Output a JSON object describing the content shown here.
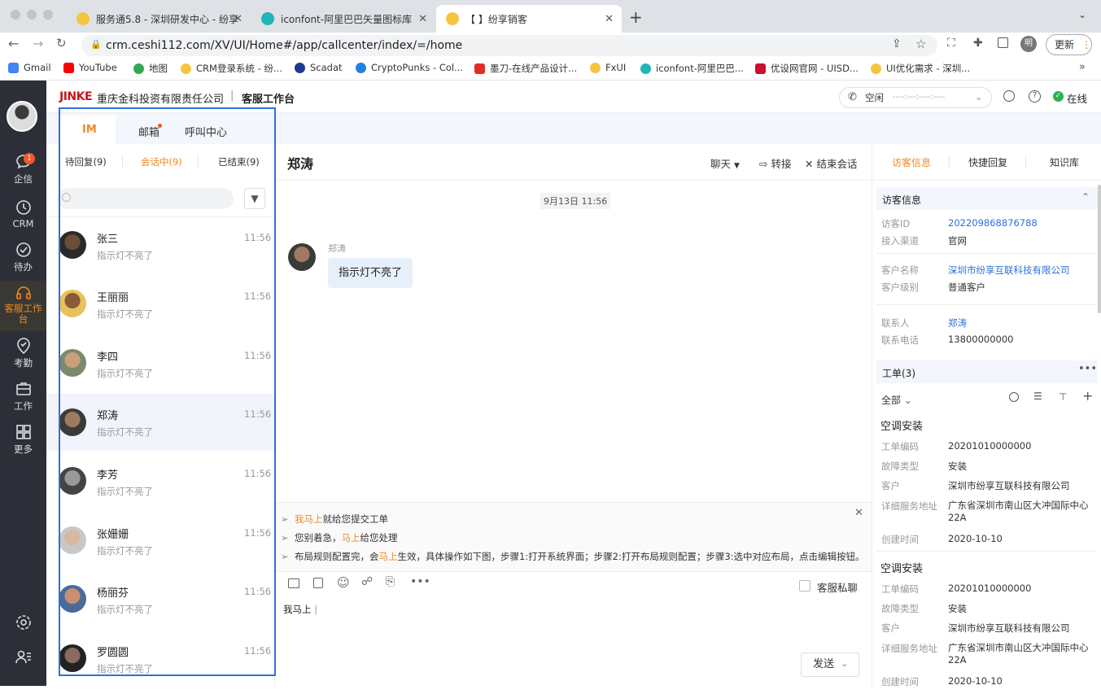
{
  "browser": {
    "tabs": [
      {
        "title": "服务通5.8 - 深圳研发中心 - 纷享"
      },
      {
        "title": "iconfont-阿里巴巴矢量图标库"
      },
      {
        "title": "【        】纷享销客"
      }
    ],
    "url": "crm.ceshi112.com/XV/UI/Home#/app/callcenter/index/=/home",
    "update_label": "更新",
    "profile_initial": "明",
    "bookmarks": [
      "Gmail",
      "YouTube",
      "地图",
      "CRM登录系统 - 纷...",
      "Scadat",
      "CryptoPunks - Col...",
      "墨刀-在线产品设计...",
      "FxUI",
      "iconfont-阿里巴巴...",
      "优设网官网 - UISD...",
      "UI优化需求 - 深圳..."
    ],
    "more_bookmarks": "»"
  },
  "sidenav": {
    "badge": "1",
    "items": [
      "企信",
      "CRM",
      "待办",
      "客服工作台",
      "考勤",
      "工作",
      "更多"
    ]
  },
  "header": {
    "logo": "JINKE",
    "company": "重庆金科投资有限责任公司",
    "separator": "|",
    "workspace": "客服工作台",
    "status_select": "空闲",
    "status_time": "----:---:----:----",
    "online": "在线"
  },
  "conv": {
    "tabs": [
      "IM",
      "邮箱",
      "呼叫中心"
    ],
    "subtabs": [
      "待回复(9)",
      "会话中(9)",
      "已结束(9)"
    ],
    "search_placeholder": "",
    "items": [
      {
        "name": "张三",
        "preview": "指示灯不亮了",
        "time": "11:56"
      },
      {
        "name": "王丽丽",
        "preview": "指示灯不亮了",
        "time": "11:56"
      },
      {
        "name": "李四",
        "preview": "指示灯不亮了",
        "time": "11:56"
      },
      {
        "name": "郑涛",
        "preview": "指示灯不亮了",
        "time": "11:56"
      },
      {
        "name": "李芳",
        "preview": "指示灯不亮了",
        "time": "11:56"
      },
      {
        "name": "张姗姗",
        "preview": "指示灯不亮了",
        "time": "11:56"
      },
      {
        "name": "杨丽芬",
        "preview": "指示灯不亮了",
        "time": "11:56"
      },
      {
        "name": "罗圆圆",
        "preview": "指示灯不亮了",
        "time": "11:56"
      }
    ]
  },
  "chat": {
    "title": "郑涛",
    "mode": "聊天",
    "transfer": "转接",
    "end": "结束会话",
    "date": "9月13日  11:56",
    "sender": "郑涛",
    "message": "指示灯不亮了",
    "suggestions": [
      {
        "before": "",
        "hl": "我马上",
        "after": "就给您提交工单"
      },
      {
        "before": "您别着急，",
        "hl": "马上",
        "after": "给您处理"
      },
      {
        "before": "布局规则配置完，会",
        "hl": "马上",
        "after": "生效，具体操作如下图，步骤1:打开系统界面；步骤2:打开布局规则配置；步骤3:选中对应布局，点击编辑按钮。..."
      }
    ],
    "private_label": "客服私聊",
    "draft": "我马上",
    "send": "发送"
  },
  "right": {
    "tabs": [
      "访客信息",
      "快捷回复",
      "知识库"
    ],
    "visitor_section": "访客信息",
    "fields": [
      {
        "k": "访客ID",
        "v": "202209868876788",
        "link": true
      },
      {
        "k": "接入渠道",
        "v": "官网",
        "link": false
      },
      {
        "k": "客户名称",
        "v": "深圳市纷享互联科技有限公司",
        "link": true
      },
      {
        "k": "客户级别",
        "v": "普通客户",
        "link": false
      },
      {
        "k": "联系人",
        "v": "郑涛",
        "link": true
      },
      {
        "k": "联系电话",
        "v": "13800000000",
        "link": false
      }
    ],
    "orders_section": "工单(3)",
    "filter": "全部",
    "orders": [
      {
        "title": "空调安装",
        "rows": [
          {
            "k": "工单编码",
            "v": "20201010000000"
          },
          {
            "k": "故障类型",
            "v": "安装"
          },
          {
            "k": "客户",
            "v": "深圳市纷享互联科技有限公司"
          },
          {
            "k": "详细服务地址",
            "v": "广东省深圳市南山区大冲国际中心22A"
          },
          {
            "k": "创建时间",
            "v": "2020-10-10"
          }
        ]
      },
      {
        "title": "空调安装",
        "rows": [
          {
            "k": "工单编码",
            "v": "20201010000000"
          },
          {
            "k": "故障类型",
            "v": "安装"
          },
          {
            "k": "客户",
            "v": "深圳市纷享互联科技有限公司"
          },
          {
            "k": "详细服务地址",
            "v": "广东省深圳市南山区大冲国际中心22A"
          },
          {
            "k": "创建时间",
            "v": "2020-10-10"
          }
        ]
      }
    ]
  },
  "colors": {
    "accent": "#f08a24",
    "link": "#2f6fdc",
    "nav_bg": "#2c2f38",
    "highlight": "#2f6fdc"
  }
}
